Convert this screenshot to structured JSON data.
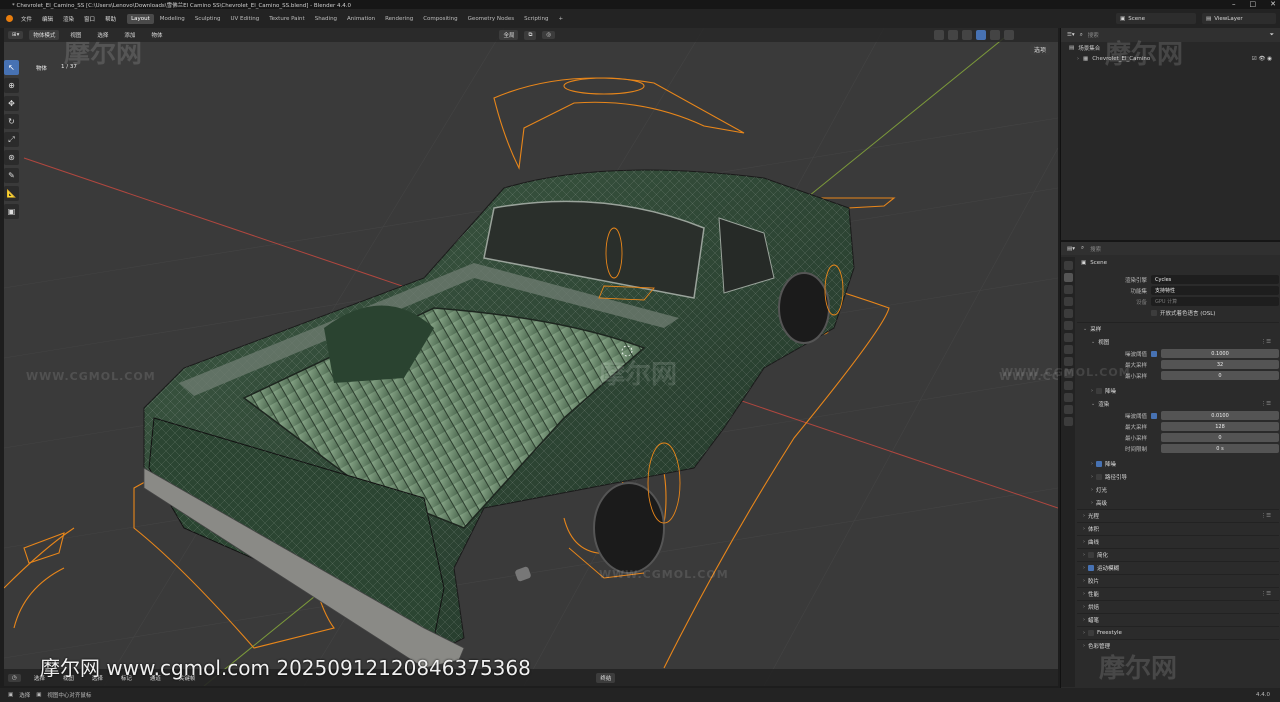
{
  "window": {
    "title": "* Chevrolet_El_Camino_SS [C:\\Users\\Lenovo\\Downloads\\雪佛兰El Camino SS\\Chevrolet_El_Camino_SS.blend] - Blender 4.4.0",
    "controls": [
      "–",
      "□",
      "✕"
    ]
  },
  "menubar": {
    "menus": [
      "文件",
      "编辑",
      "渲染",
      "窗口",
      "帮助"
    ],
    "workspaces": [
      "Layout",
      "Modeling",
      "Sculpting",
      "UV Editing",
      "Texture Paint",
      "Shading",
      "Animation",
      "Rendering",
      "Compositing",
      "Geometry Nodes",
      "Scripting",
      "+"
    ],
    "active_workspace": "Layout",
    "scene": "Scene",
    "view_layer": "ViewLayer"
  },
  "viewport": {
    "mode": "物体模式",
    "menus": [
      "视图",
      "选择",
      "添加",
      "物体"
    ],
    "transform": "全局",
    "options": "选项",
    "object_label": "物体",
    "object_count": "1 / 37",
    "bottom_items": [
      "选择",
      "视图",
      "选择",
      "标记",
      "通道",
      "关键帧"
    ],
    "bottom_mid": "终结"
  },
  "outliner": {
    "search_placeholder": "搜索",
    "rows": [
      {
        "label": "场景集合"
      },
      {
        "label": "Chevrolet_El_Camino"
      }
    ]
  },
  "properties": {
    "search_placeholder": "搜索",
    "scene_name": "Scene",
    "render_engine_label": "渲染引擎",
    "render_engine": "Cycles",
    "feature_set_label": "功能集",
    "feature_set": "支持特性",
    "device_label": "设备",
    "device": "GPU 计算",
    "osl_label": "开放式着色语言 (OSL)",
    "sections": {
      "sampling": "采样",
      "viewport": "视图",
      "noise_threshold_label": "噪波阈值",
      "vp_noise_threshold": "0.1000",
      "max_samples_label": "最大采样",
      "vp_max_samples": "32",
      "min_samples_label": "最小采样",
      "vp_min_samples": "0",
      "denoise": "降噪",
      "render": "渲染",
      "r_noise_threshold": "0.0100",
      "r_max_samples": "128",
      "r_min_samples": "0",
      "time_limit_label": "时间限制",
      "r_time_limit": "0 s",
      "denoise2": "降噪",
      "path_guiding": "路径引导",
      "lights": "灯光",
      "advanced": "高级",
      "light_paths": "光程",
      "volumes": "体积",
      "curves": "曲线",
      "simplify": "简化",
      "motion_blur": "运动模糊",
      "film": "胶片",
      "performance": "性能",
      "bake": "烘焙",
      "grease_pencil": "蜡笔",
      "freestyle": "Freestyle",
      "color_management": "色彩管理"
    }
  },
  "statusbar": {
    "left": "选择",
    "hint": "视图中心对齐鼠标",
    "version": "4.4.0"
  },
  "watermark": {
    "text": "摩尔网 www.cgmol.com 20250912120846375368",
    "logo": "摩尔网",
    "url": "WWW.CGMOL.COM"
  },
  "colors": {
    "accent": "#4772b3",
    "selection_orange": "#e8861a",
    "car_green": "#2f4a36",
    "grid_red": "#b0473f",
    "grid_green": "#7c9a3a"
  }
}
